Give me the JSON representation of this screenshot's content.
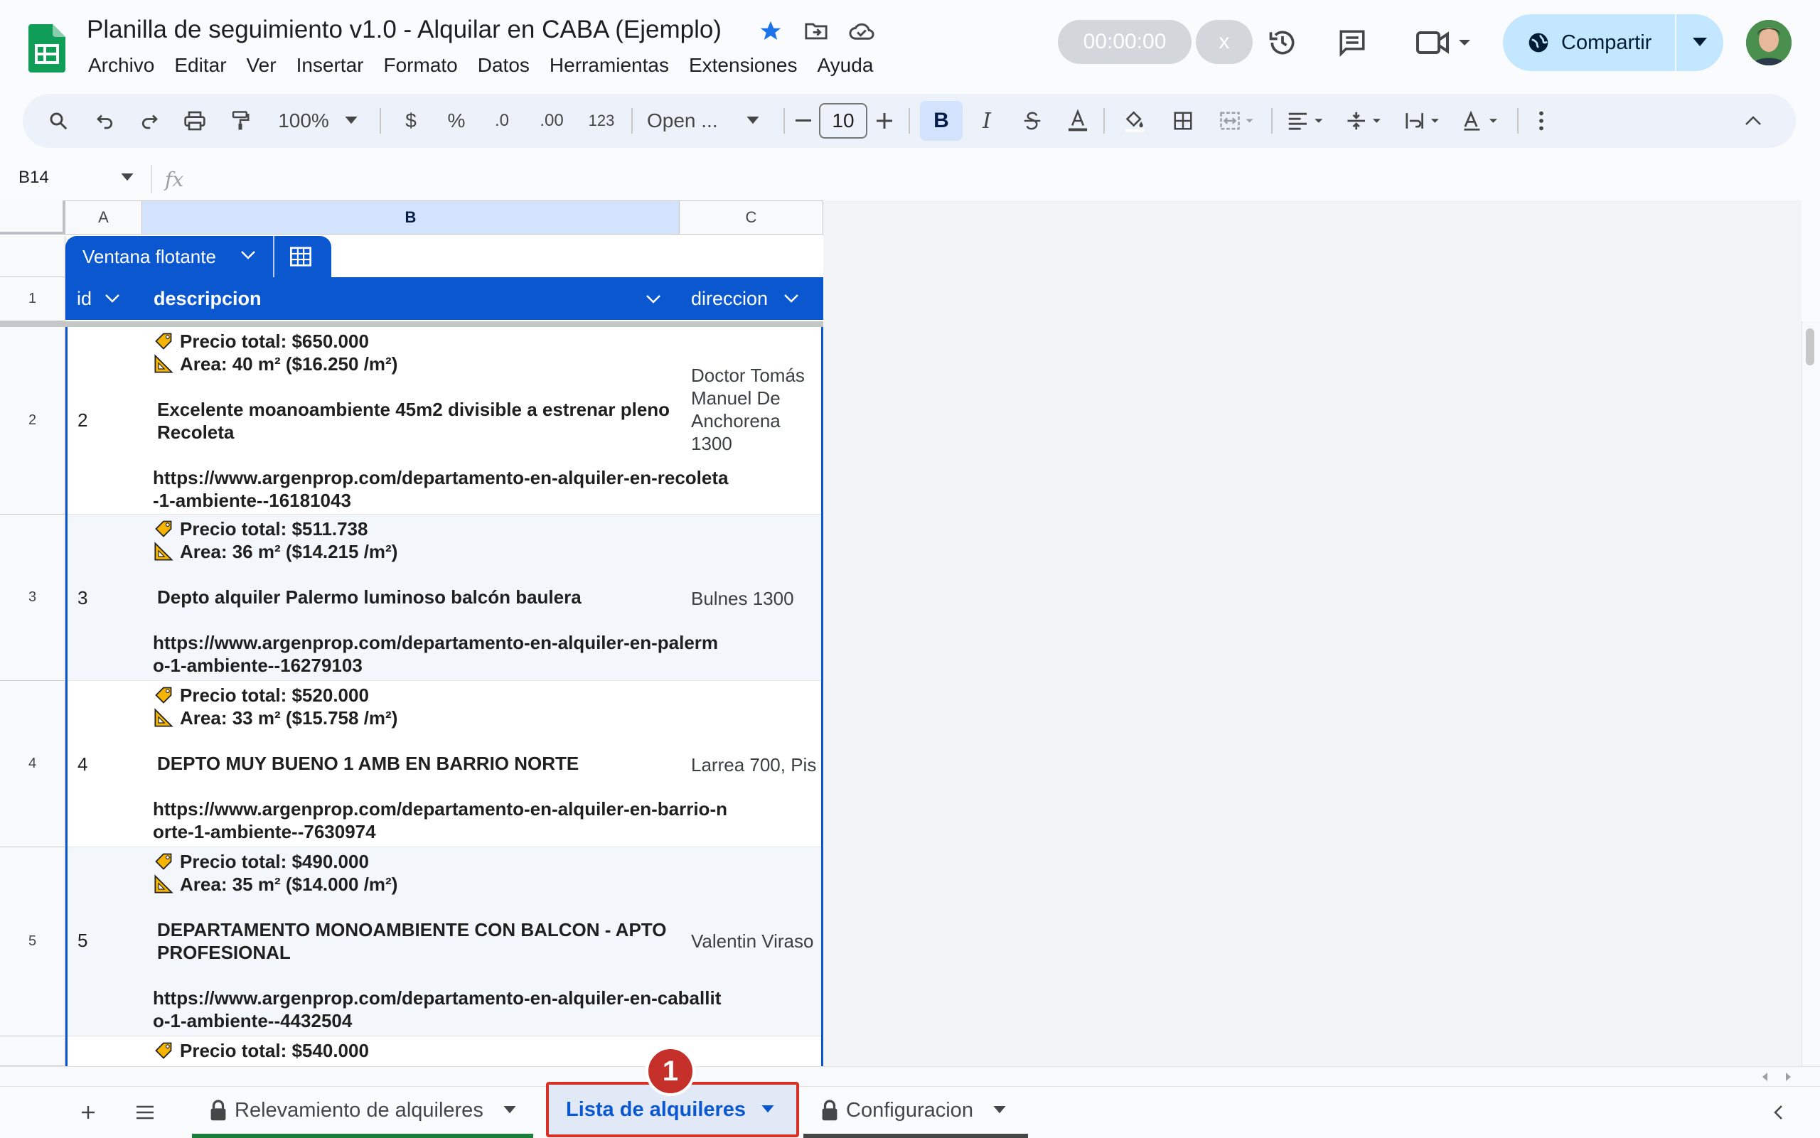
{
  "header": {
    "title": "Planilla de seguimiento v1.0 - Alquilar en CABA (Ejemplo)",
    "menu": [
      "Archivo",
      "Editar",
      "Ver",
      "Insertar",
      "Formato",
      "Datos",
      "Herramientas",
      "Extensiones",
      "Ayuda"
    ],
    "timer": "00:00:00",
    "timer_close": "x",
    "share_label": "Compartir"
  },
  "toolbar": {
    "zoom": "100%",
    "currency": "$",
    "percent": "%",
    "dec_decrease": ".0",
    "dec_increase": ".00",
    "number_format": "123",
    "font_name": "Open ...",
    "font_size": "10",
    "bold": "B",
    "italic": "I"
  },
  "formula_bar": {
    "cell_ref": "B14",
    "fx": "fx"
  },
  "grid": {
    "columns": [
      "A",
      "B",
      "C"
    ],
    "row_numbers": [
      "1",
      "2",
      "3",
      "4",
      "5"
    ]
  },
  "table": {
    "name": "Ventana flotante",
    "headers": [
      "id",
      "descripcion",
      "direccion"
    ],
    "rows": [
      {
        "id": "2",
        "precio": "Precio total: $650.000",
        "area": "Area:  40 m² ($16.250 /m²)",
        "titulo": "Excelente moanoambiente 45m2 divisible a estrenar pleno Recoleta",
        "url": "https://www.argenprop.com/departamento-en-alquiler-en-recoleta-1-ambiente--16181043",
        "direccion": "Doctor Tomás Manuel De Anchorena 1300"
      },
      {
        "id": "3",
        "precio": "Precio total: $511.738",
        "area": "Area:  36 m² ($14.215 /m²)",
        "titulo": "Depto alquiler Palermo luminoso balcón baulera",
        "url": "https://www.argenprop.com/departamento-en-alquiler-en-palermo-1-ambiente--16279103",
        "direccion": "Bulnes 1300"
      },
      {
        "id": "4",
        "precio": "Precio total: $520.000",
        "area": "Area:  33 m² ($15.758 /m²)",
        "titulo": "DEPTO MUY BUENO 1 AMB EN BARRIO NORTE",
        "url": "https://www.argenprop.com/departamento-en-alquiler-en-barrio-norte-1-ambiente--7630974",
        "direccion": "Larrea 700, Pis"
      },
      {
        "id": "5",
        "precio": "Precio total: $490.000",
        "area": "Area:  35 m² ($14.000 /m²)",
        "titulo": "DEPARTAMENTO MONOAMBIENTE CON BALCON - APTO PROFESIONAL",
        "url": "https://www.argenprop.com/departamento-en-alquiler-en-caballito-1-ambiente--4432504",
        "direccion": "Valentin Viraso"
      }
    ],
    "partial_row_precio": "Precio total: $540.000"
  },
  "sheets": {
    "tabs": [
      "Relevamiento de alquileres",
      "Lista de alquileres",
      "Configuracion"
    ],
    "active": "Lista de alquileres",
    "callout": "1"
  },
  "colors": {
    "accent": "#0b57d0",
    "share_bg": "#c2e7ff",
    "callout": "#c5302a"
  }
}
